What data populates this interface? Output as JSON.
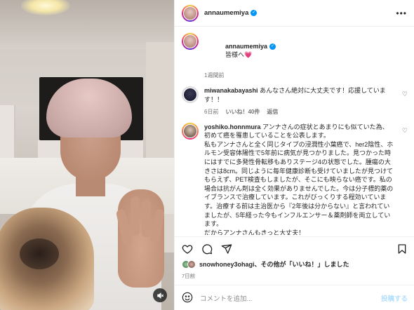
{
  "post": {
    "username": "annaumemiya",
    "more_label": "•••"
  },
  "caption": {
    "username": "annaumemiya",
    "text": "皆様へ",
    "heart": "💗",
    "time": "1週間前"
  },
  "comments": [
    {
      "username": "miwanakabayashi",
      "text": "あんなさん絶対に大丈夫です！応援しています！！",
      "time": "6日前",
      "likes": "いいね！40件",
      "reply": "返信"
    },
    {
      "username": "yoshiko.honnmura",
      "text": "アンナさんの症状とあまりにも似ていた為、\n初めて癌を罹患していることを公表します。\n私もアンナさんと全く同じタイプの浸潤性小葉癌で、her2陰性、ホルモン受容体陽性で5年前に病気が見つかりました。見つかった時にはすでに多発性骨転移もありステージ4の状態でした。腫瘍の大きさは8cm。同じように毎年健康診断も受けていましたが見つけてもらえず、PET検査もしましたが、そこにも映らない癌です。私の場合は抗がん剤は全く効果がありませんでした。今は分子標的薬のイブランスで治療しています。これがびっくりする程効いています。治療する前は主治医から『2年後は分からない』と言われていましたが、5年経った今もインフルエンサー＆薬剤師を両立しています。\nだからアンナさんもきっと大丈夫！\nそして私もアンナさんと同じ歳の娘がいます。"
    }
  ],
  "likes_summary": {
    "user": "snowhoney3ohagi",
    "text": "、その他が「いいね！」しました"
  },
  "date": "7日前",
  "add_comment": {
    "placeholder": "コメントを追加...",
    "post_label": "投稿する"
  },
  "icons": {
    "heart": "heart-icon",
    "comment": "comment-icon",
    "share": "share-icon",
    "save": "bookmark-icon",
    "emoji": "emoji-icon",
    "mute": "speaker-muted-icon"
  },
  "colors": {
    "verified": "#0095f6",
    "meta": "#737373",
    "post_disabled": "#b2dffc"
  }
}
